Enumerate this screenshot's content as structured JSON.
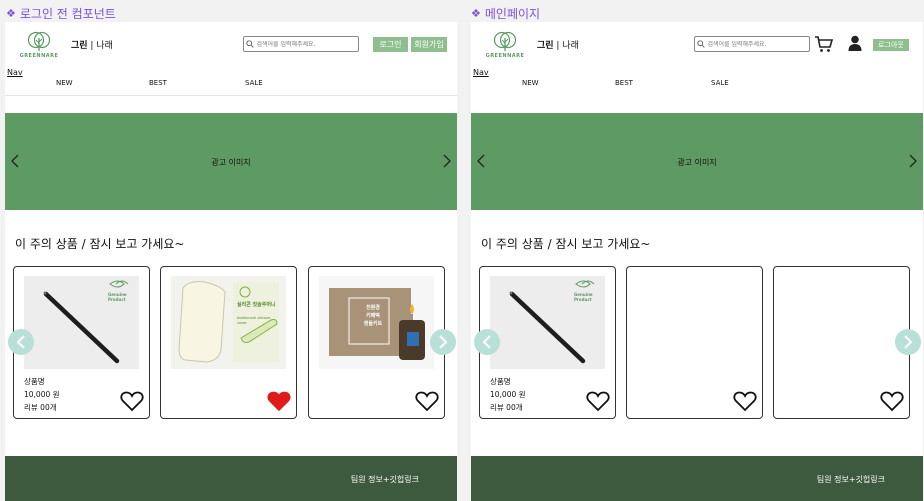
{
  "frames": {
    "left": {
      "label": "로그인 전 컴포넌트"
    },
    "right": {
      "label": "메인페이지"
    }
  },
  "header": {
    "logo_word": "GREENNARE",
    "brand_left": "그린",
    "brand_sep": " | ",
    "brand_right": "나래",
    "search_placeholder": "검색어를 입력해주세요.",
    "login_label": "로그인",
    "signup_label": "회원가입",
    "logout_label": "로그아웃"
  },
  "nav": {
    "label": "Nav",
    "items": [
      "NEW",
      "BEST",
      "SALE"
    ]
  },
  "banner": {
    "text": "광고 이미지"
  },
  "section": {
    "title": "이 주의 상품 / 잠시 보고 가세요~"
  },
  "product": {
    "name": "상품명",
    "price": "10,000 원",
    "reviews": "리뷰 00개"
  },
  "product_images": {
    "badge_text": "Genuine Product",
    "pouch_title": "실리콘 칫솔주머니",
    "pouch_sub": "toothbrush silicone cover",
    "box_lines": [
      "친환경",
      "키패떡",
      "캔들키트"
    ]
  },
  "footer": {
    "text": "팀원 정보+깃헙링크"
  },
  "colors": {
    "brand_green": "#5e9a63",
    "button_green": "#8fbf8e",
    "footer_green": "#3e5a3e",
    "pager_mint": "#b9e0d6",
    "liked_heart": "#e01b1b",
    "frame_label": "#7b4fe0"
  },
  "icons": {
    "search": "magnifier-icon",
    "cart": "cart-icon",
    "user": "user-icon",
    "heart": "heart-icon",
    "prev": "chevron-left-icon",
    "next": "chevron-right-icon"
  }
}
